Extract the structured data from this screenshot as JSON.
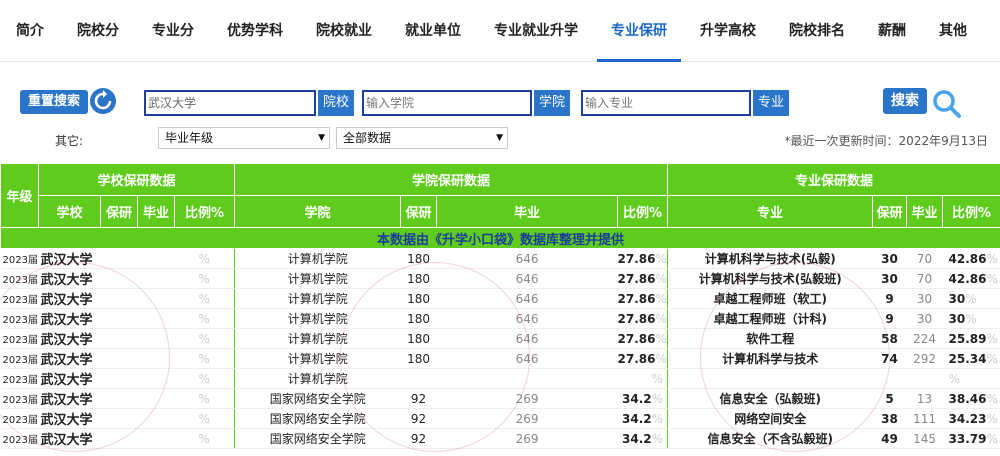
{
  "nav": {
    "items": [
      "简介",
      "院校分",
      "专业分",
      "优势学科",
      "院校就业",
      "就业单位",
      "专业就业升学",
      "专业保研",
      "升学高校",
      "院校排名",
      "薪酬",
      "其他"
    ],
    "active_index": 7
  },
  "search": {
    "reset_label": "重置搜索",
    "school_value": "武汉大学",
    "school_tag": "院校",
    "college_placeholder": "输入学院",
    "college_tag": "学院",
    "major_placeholder": "输入专业",
    "major_tag": "专业",
    "search_label": "搜索"
  },
  "filters": {
    "other_label": "其它:",
    "year_select": "毕业年级",
    "data_select": "全部数据",
    "update_text": "*最近一次更新时间：2022年9月13日"
  },
  "table": {
    "banner": "本数据由《升学小口袋》数据库整理并提供",
    "group_headers": {
      "year": "年级",
      "school_group": "学校保研数据",
      "college_group": "学院保研数据",
      "major_group": "专业保研数据"
    },
    "sub_headers": {
      "school": "学校",
      "s_baoyan": "保研",
      "s_grad": "毕业",
      "s_ratio": "比例%",
      "college": "学院",
      "c_baoyan": "保研",
      "c_grad": "毕业",
      "c_ratio": "比例%",
      "major": "专业",
      "m_baoyan": "保研",
      "m_grad": "毕业",
      "m_ratio": "比例%"
    },
    "rows": [
      {
        "year": "2023届",
        "school": "武汉大学",
        "s_ratio": "%",
        "college": "计算机学院",
        "c_baoyan": "180",
        "c_grad": "646",
        "c_ratio": "27.86",
        "c_pct": "%",
        "major": "计算机科学与技术(弘毅)",
        "m_baoyan": "30",
        "m_grad": "70",
        "m_ratio": "42.86",
        "m_pct": "%"
      },
      {
        "year": "2023届",
        "school": "武汉大学",
        "s_ratio": "%",
        "college": "计算机学院",
        "c_baoyan": "180",
        "c_grad": "646",
        "c_ratio": "27.86",
        "c_pct": "%",
        "major": "计算机科学与技术(弘毅班)",
        "m_baoyan": "30",
        "m_grad": "70",
        "m_ratio": "42.86",
        "m_pct": "%"
      },
      {
        "year": "2023届",
        "school": "武汉大学",
        "s_ratio": "%",
        "college": "计算机学院",
        "c_baoyan": "180",
        "c_grad": "646",
        "c_ratio": "27.86",
        "c_pct": "%",
        "major": "卓越工程师班（软工)",
        "m_baoyan": "9",
        "m_grad": "30",
        "m_ratio": "30",
        "m_pct": "%"
      },
      {
        "year": "2023届",
        "school": "武汉大学",
        "s_ratio": "%",
        "college": "计算机学院",
        "c_baoyan": "180",
        "c_grad": "646",
        "c_ratio": "27.86",
        "c_pct": "%",
        "major": "卓越工程师班（计科)",
        "m_baoyan": "9",
        "m_grad": "30",
        "m_ratio": "30",
        "m_pct": "%"
      },
      {
        "year": "2023届",
        "school": "武汉大学",
        "s_ratio": "%",
        "college": "计算机学院",
        "c_baoyan": "180",
        "c_grad": "646",
        "c_ratio": "27.86",
        "c_pct": "%",
        "major": "软件工程",
        "m_baoyan": "58",
        "m_grad": "224",
        "m_ratio": "25.89",
        "m_pct": "%"
      },
      {
        "year": "2023届",
        "school": "武汉大学",
        "s_ratio": "%",
        "college": "计算机学院",
        "c_baoyan": "180",
        "c_grad": "646",
        "c_ratio": "27.86",
        "c_pct": "%",
        "major": "计算机科学与技术",
        "m_baoyan": "74",
        "m_grad": "292",
        "m_ratio": "25.34",
        "m_pct": "%"
      },
      {
        "year": "2023届",
        "school": "武汉大学",
        "s_ratio": "%",
        "college": "计算机学院",
        "c_baoyan": "",
        "c_grad": "",
        "c_ratio": "",
        "c_pct": "%",
        "major": "",
        "m_baoyan": "",
        "m_grad": "",
        "m_ratio": "",
        "m_pct": "%"
      },
      {
        "year": "2023届",
        "school": "武汉大学",
        "s_ratio": "%",
        "college": "国家网络安全学院",
        "c_baoyan": "92",
        "c_grad": "269",
        "c_ratio": "34.2",
        "c_pct": "%",
        "major": "信息安全（弘毅班)",
        "m_baoyan": "5",
        "m_grad": "13",
        "m_ratio": "38.46",
        "m_pct": "%"
      },
      {
        "year": "2023届",
        "school": "武汉大学",
        "s_ratio": "%",
        "college": "国家网络安全学院",
        "c_baoyan": "92",
        "c_grad": "269",
        "c_ratio": "34.2",
        "c_pct": "%",
        "major": "网络空间安全",
        "m_baoyan": "38",
        "m_grad": "111",
        "m_ratio": "34.23",
        "m_pct": "%"
      },
      {
        "year": "2023届",
        "school": "武汉大学",
        "s_ratio": "%",
        "college": "国家网络安全学院",
        "c_baoyan": "92",
        "c_grad": "269",
        "c_ratio": "34.2",
        "c_pct": "%",
        "major": "信息安全（不含弘毅班)",
        "m_baoyan": "49",
        "m_grad": "145",
        "m_ratio": "33.79",
        "m_pct": "%"
      }
    ]
  },
  "colors": {
    "accent_blue": "#2a74c9",
    "header_green": "#5ecb1d",
    "banner_text": "#1b3e9c",
    "active_nav": "#1a66c8"
  }
}
